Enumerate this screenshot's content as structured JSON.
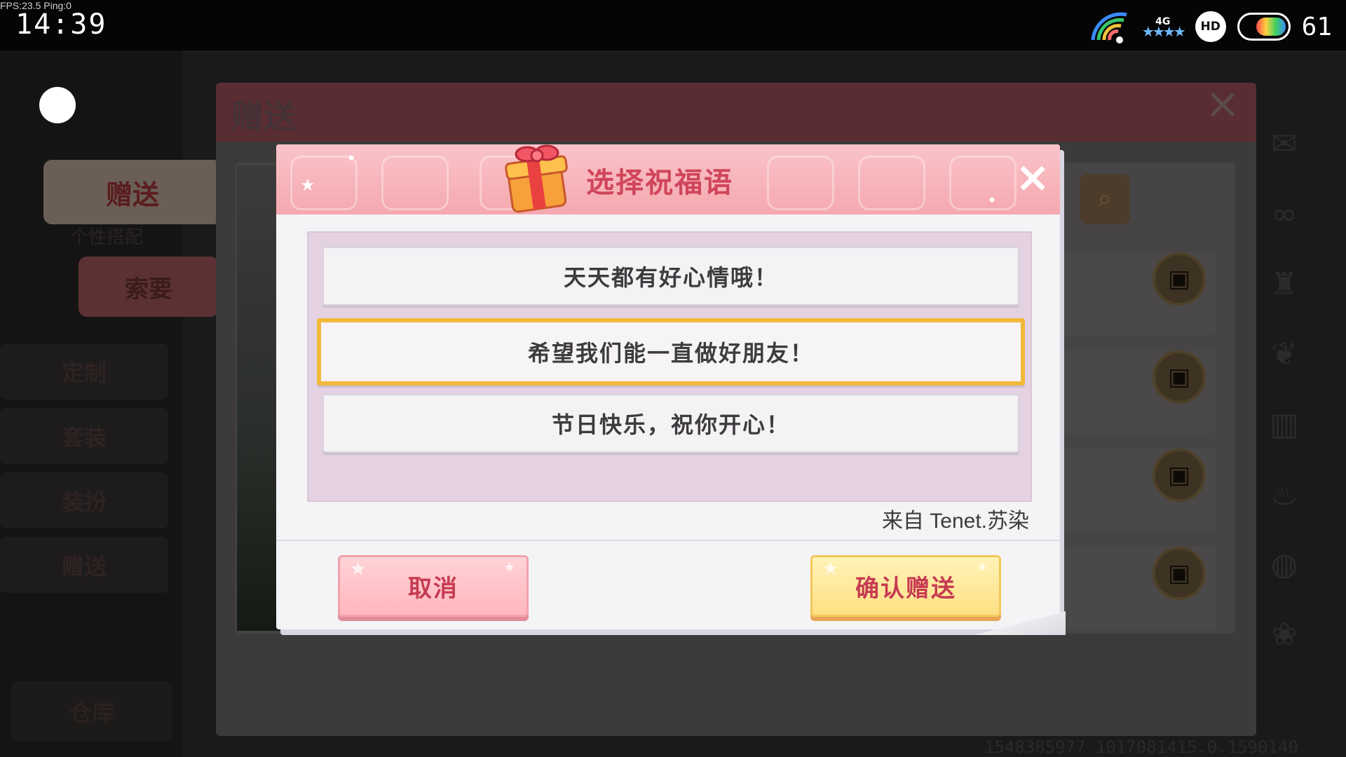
{
  "status_bar": {
    "fps": "FPS:23.5  Ping:0",
    "time": "14:39",
    "network": "4G",
    "hd": "HD",
    "battery": "61"
  },
  "background": {
    "panel_title": "赠送",
    "sidebar": {
      "give_label": "赠送",
      "sub_label": "个性搭配",
      "ask_label": "索要",
      "items": [
        "定制",
        "套装",
        "装扮",
        "赠送"
      ],
      "store_label": "仓库"
    },
    "footer_id": "1548385977  1017081415.0.1590140"
  },
  "dialog": {
    "title": "选择祝福语",
    "close": "×",
    "messages": [
      "天天都有好心情哦！",
      "希望我们能一直做好朋友！",
      "节日快乐，祝你开心！"
    ],
    "selected_index": 1,
    "from_text": "来自 Tenet.苏染",
    "cancel_label": "取消",
    "confirm_label": "确认赠送"
  },
  "colors": {
    "accent_title": "#d0455a",
    "selection_border": "#f2b83a",
    "header_pink": "#f5a8af"
  }
}
